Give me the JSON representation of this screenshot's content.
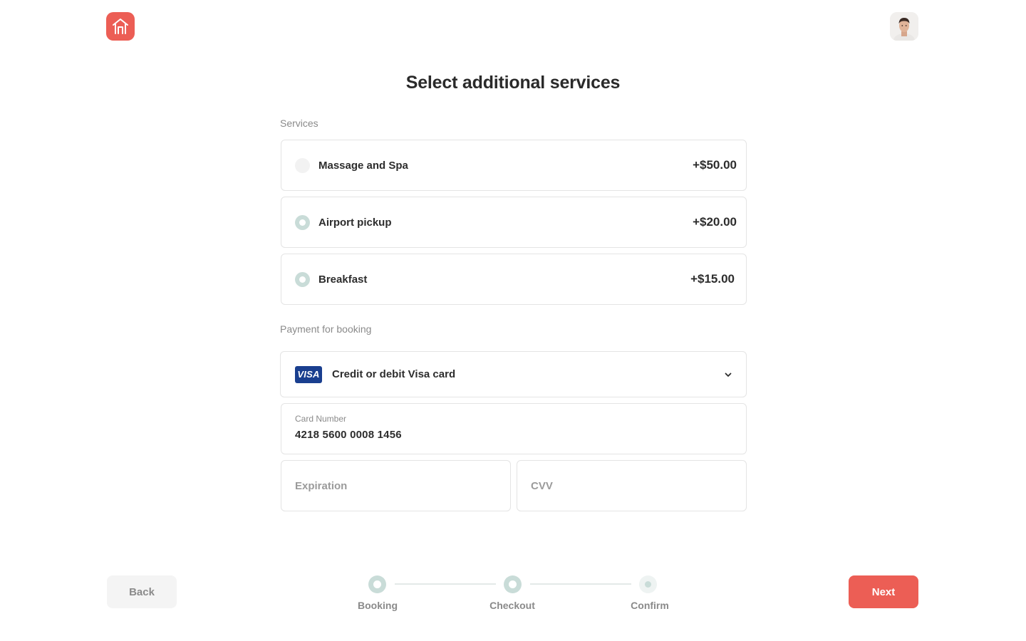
{
  "header": {
    "logo_icon": "house-icon",
    "avatar_icon": "user-avatar"
  },
  "page_title": "Select additional services",
  "services": {
    "label": "Services",
    "items": [
      {
        "name": "Massage and Spa",
        "price": "+$50.00",
        "selected": false
      },
      {
        "name": "Airport pickup",
        "price": "+$20.00",
        "selected": true
      },
      {
        "name": "Breakfast",
        "price": "+$15.00",
        "selected": true
      }
    ]
  },
  "payment": {
    "label": "Payment for booking",
    "method_badge": "VISA",
    "method_text": "Credit or debit Visa card",
    "card_number_label": "Card Number",
    "card_number_value": "4218 5600 0008 1456",
    "expiration_placeholder": "Expiration",
    "cvv_placeholder": "CVV"
  },
  "footer": {
    "back_label": "Back",
    "next_label": "Next",
    "steps": [
      {
        "label": "Booking",
        "state": "done"
      },
      {
        "label": "Checkout",
        "state": "done"
      },
      {
        "label": "Confirm",
        "state": "pending"
      }
    ]
  },
  "colors": {
    "accent": "#ec5e55",
    "radio_selected": "#c9dcd8",
    "visa_blue": "#1a3f8f"
  }
}
